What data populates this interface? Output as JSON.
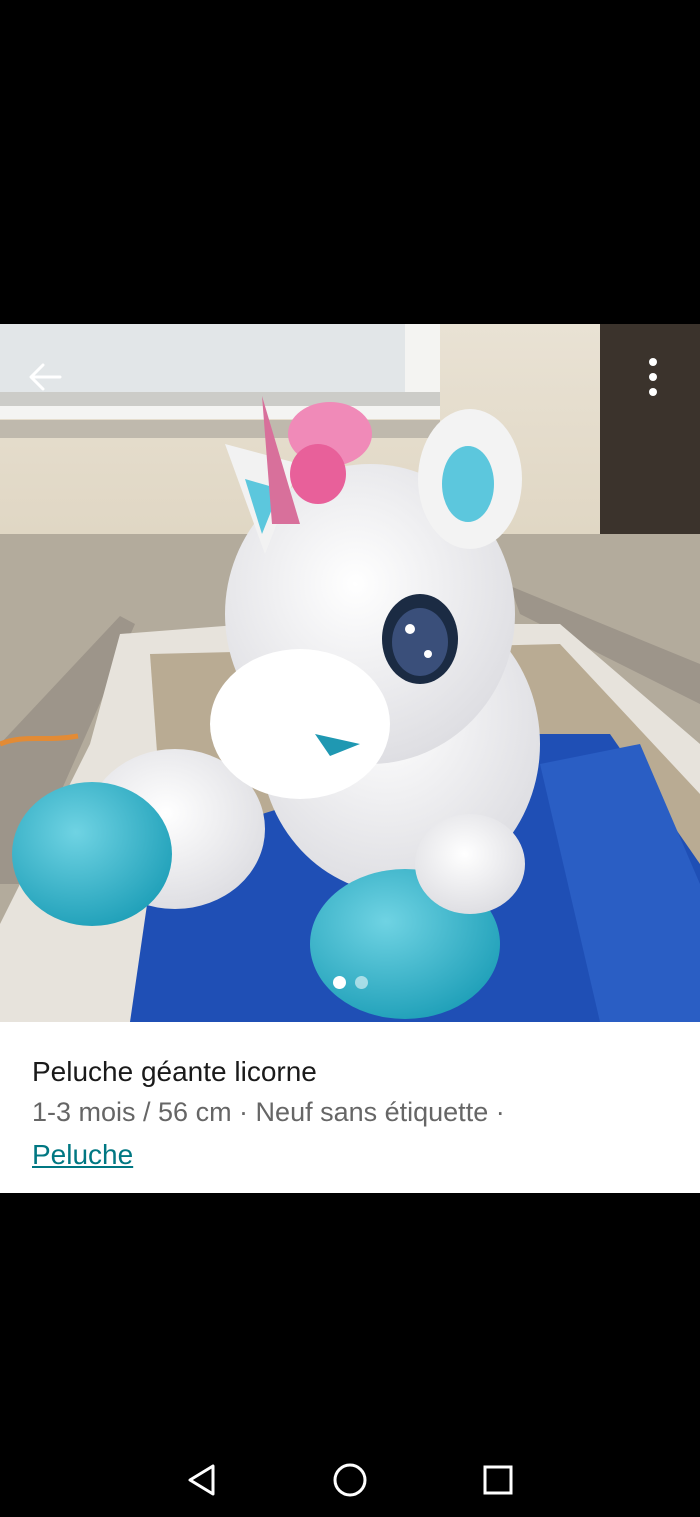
{
  "toolbar": {
    "back_icon": "arrow-left-icon",
    "more_icon": "more-vertical-icon"
  },
  "gallery": {
    "image": "unicorn plush photo",
    "page_count": 2,
    "active_index": 0
  },
  "item": {
    "title": "Peluche géante licorne",
    "meta": "1-3 mois / 56 cm · Neuf sans étiquette ·",
    "category": "Peluche"
  },
  "navbar": {
    "icons": [
      "back-triangle-icon",
      "home-circle-icon",
      "recents-square-icon"
    ]
  },
  "colors": {
    "link": "#007782",
    "page": "#000000",
    "panel": "#ffffff"
  }
}
